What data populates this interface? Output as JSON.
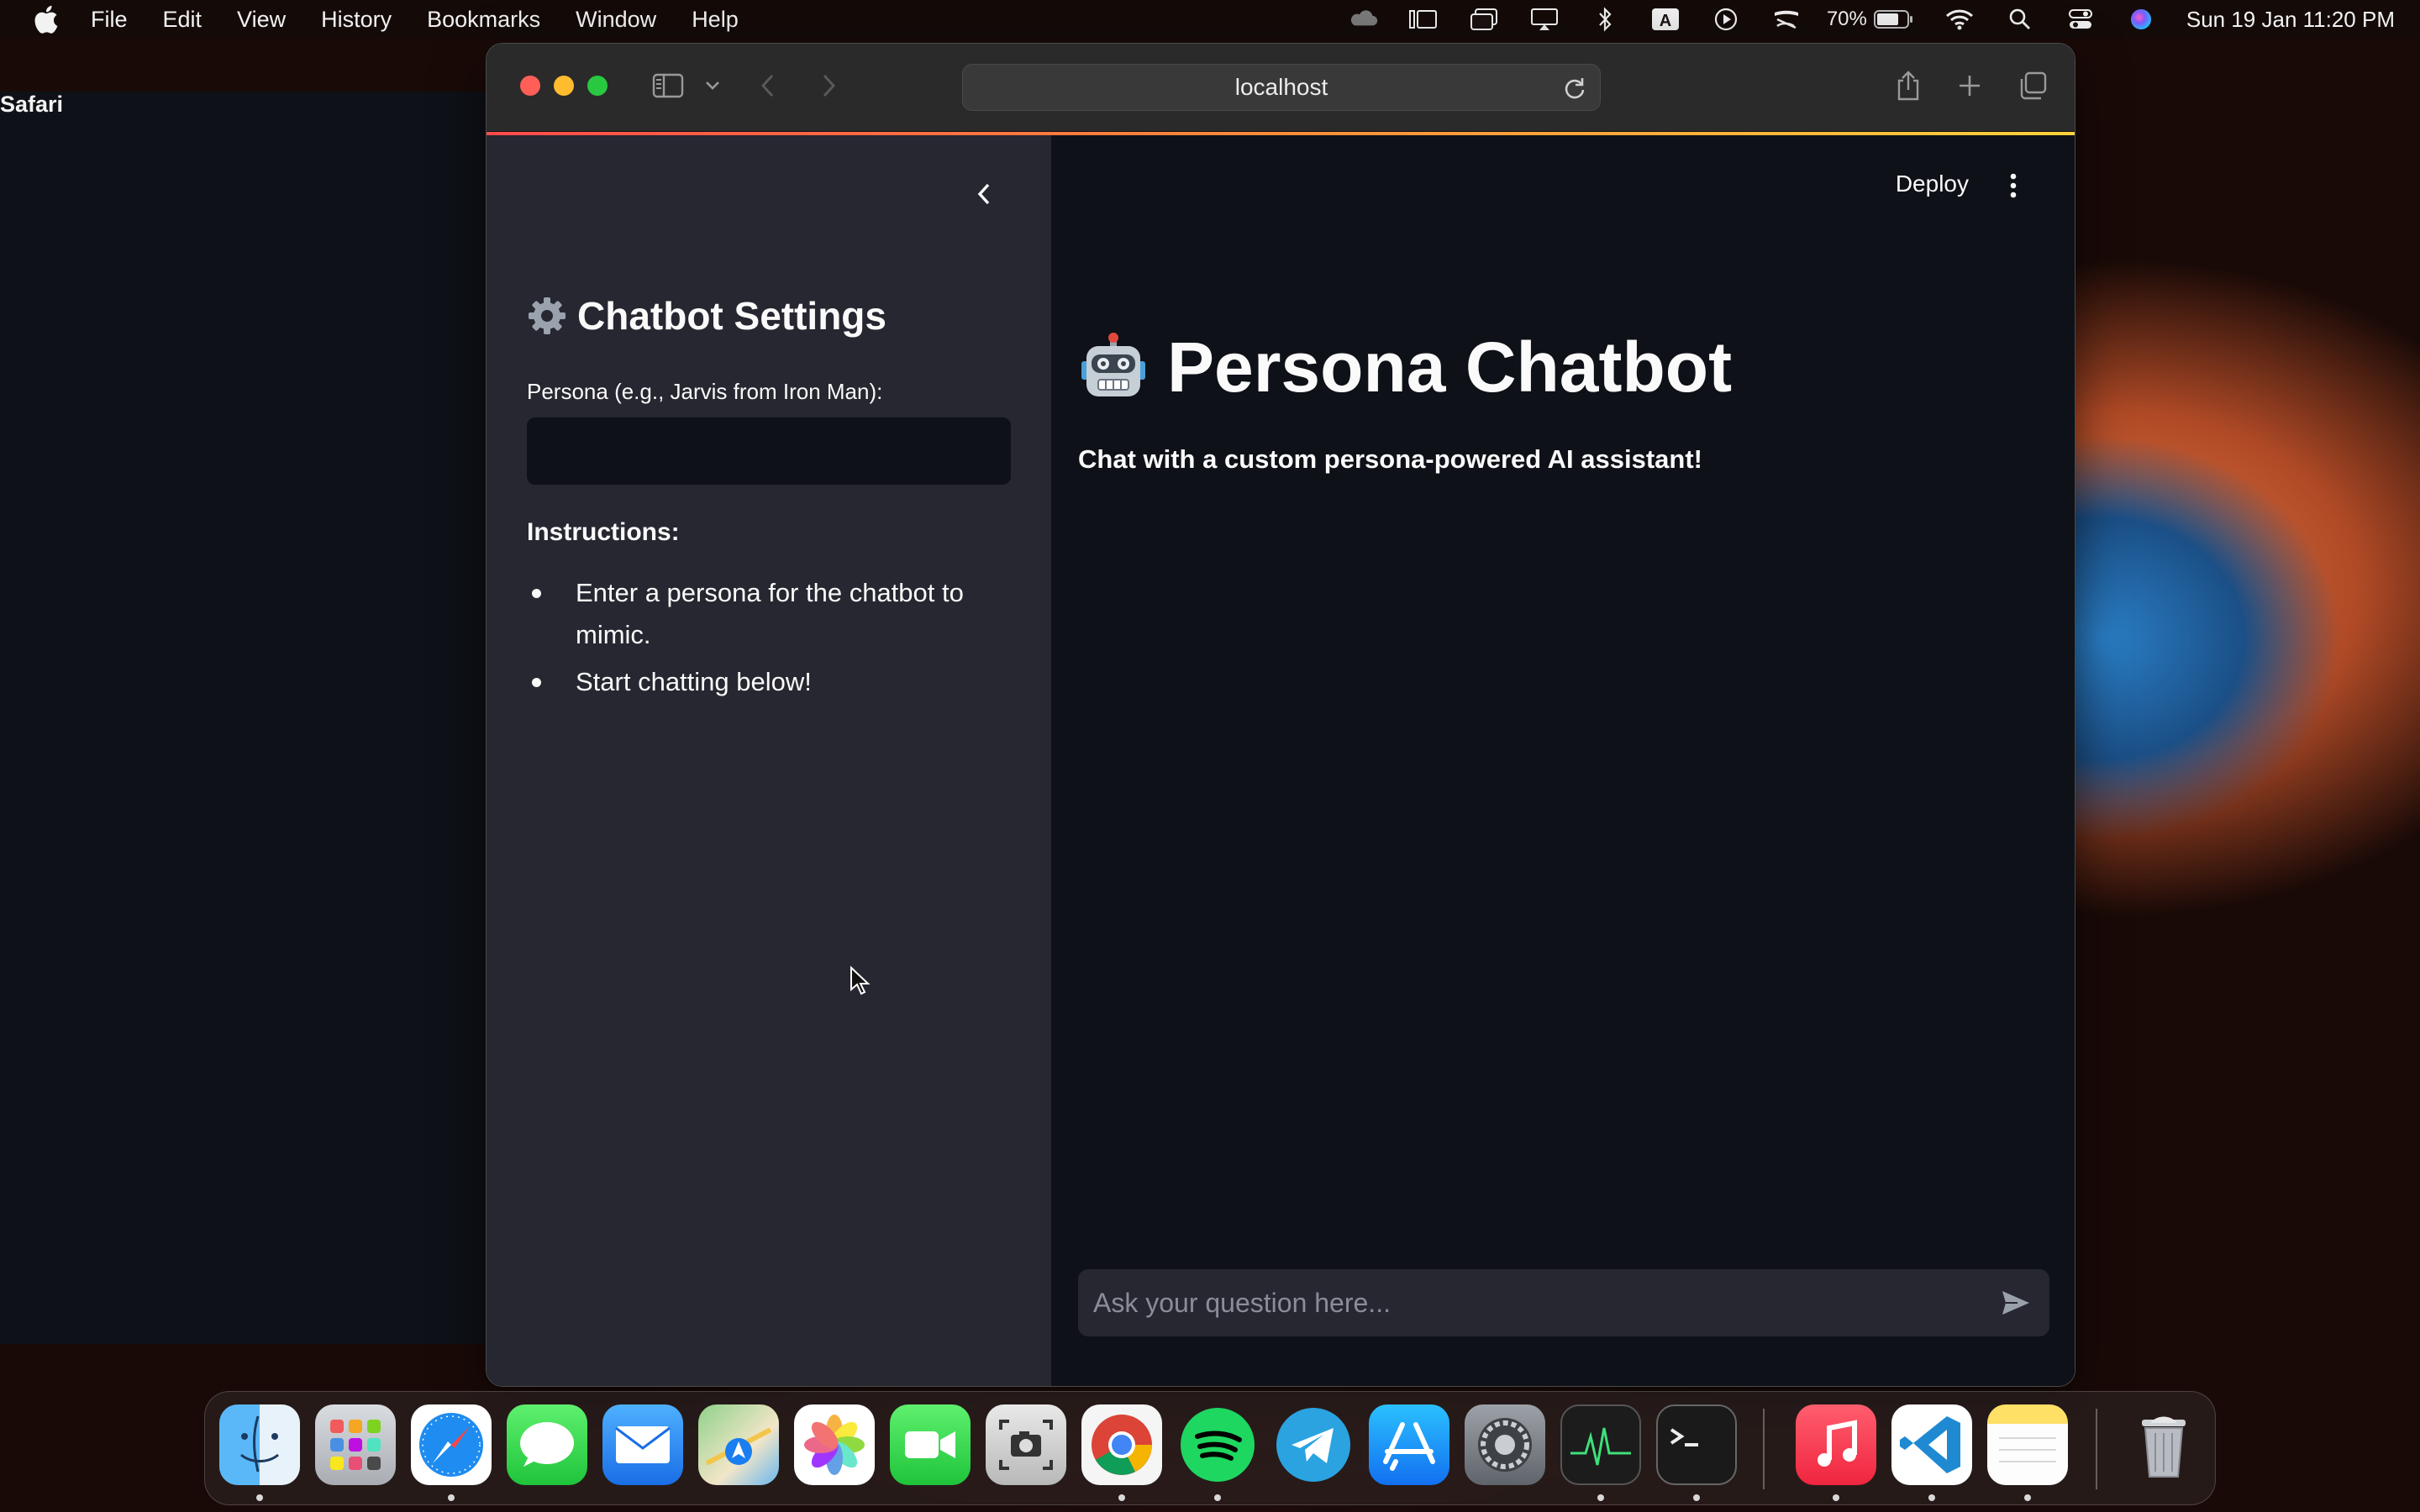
{
  "menubar": {
    "app_name": "Safari",
    "menus": [
      "File",
      "Edit",
      "View",
      "History",
      "Bookmarks",
      "Window",
      "Help"
    ],
    "battery": "70%",
    "datetime": "Sun 19 Jan  11:20 PM"
  },
  "browser": {
    "url": "localhost"
  },
  "sidebar": {
    "title": "Chatbot Settings",
    "persona_label": "Persona (e.g., Jarvis from Iron Man):",
    "persona_value": "",
    "instructions_heading": "Instructions:",
    "instructions": [
      "Enter a persona for the chatbot to mimic.",
      "Start chatting below!"
    ]
  },
  "main": {
    "deploy_label": "Deploy",
    "title": "Persona Chatbot",
    "subtitle": "Chat with a custom persona-powered AI assistant!",
    "chat_placeholder": "Ask your question here..."
  },
  "dock": {
    "apps": [
      "finder-icon",
      "launchpad-icon",
      "safari-icon",
      "messages-icon",
      "mail-icon",
      "maps-icon",
      "photos-icon",
      "facetime-icon",
      "screenshot-icon",
      "chrome-icon",
      "spotify-icon",
      "telegram-icon",
      "app-store-icon",
      "system-settings-icon",
      "activity-monitor-icon",
      "terminal-icon",
      "music-icon",
      "vscode-icon",
      "notes-icon",
      "trash-icon"
    ]
  },
  "colors": {
    "sidebar_bg": "#262730",
    "main_bg": "#0e1117",
    "accent": "#ff4b4b"
  }
}
